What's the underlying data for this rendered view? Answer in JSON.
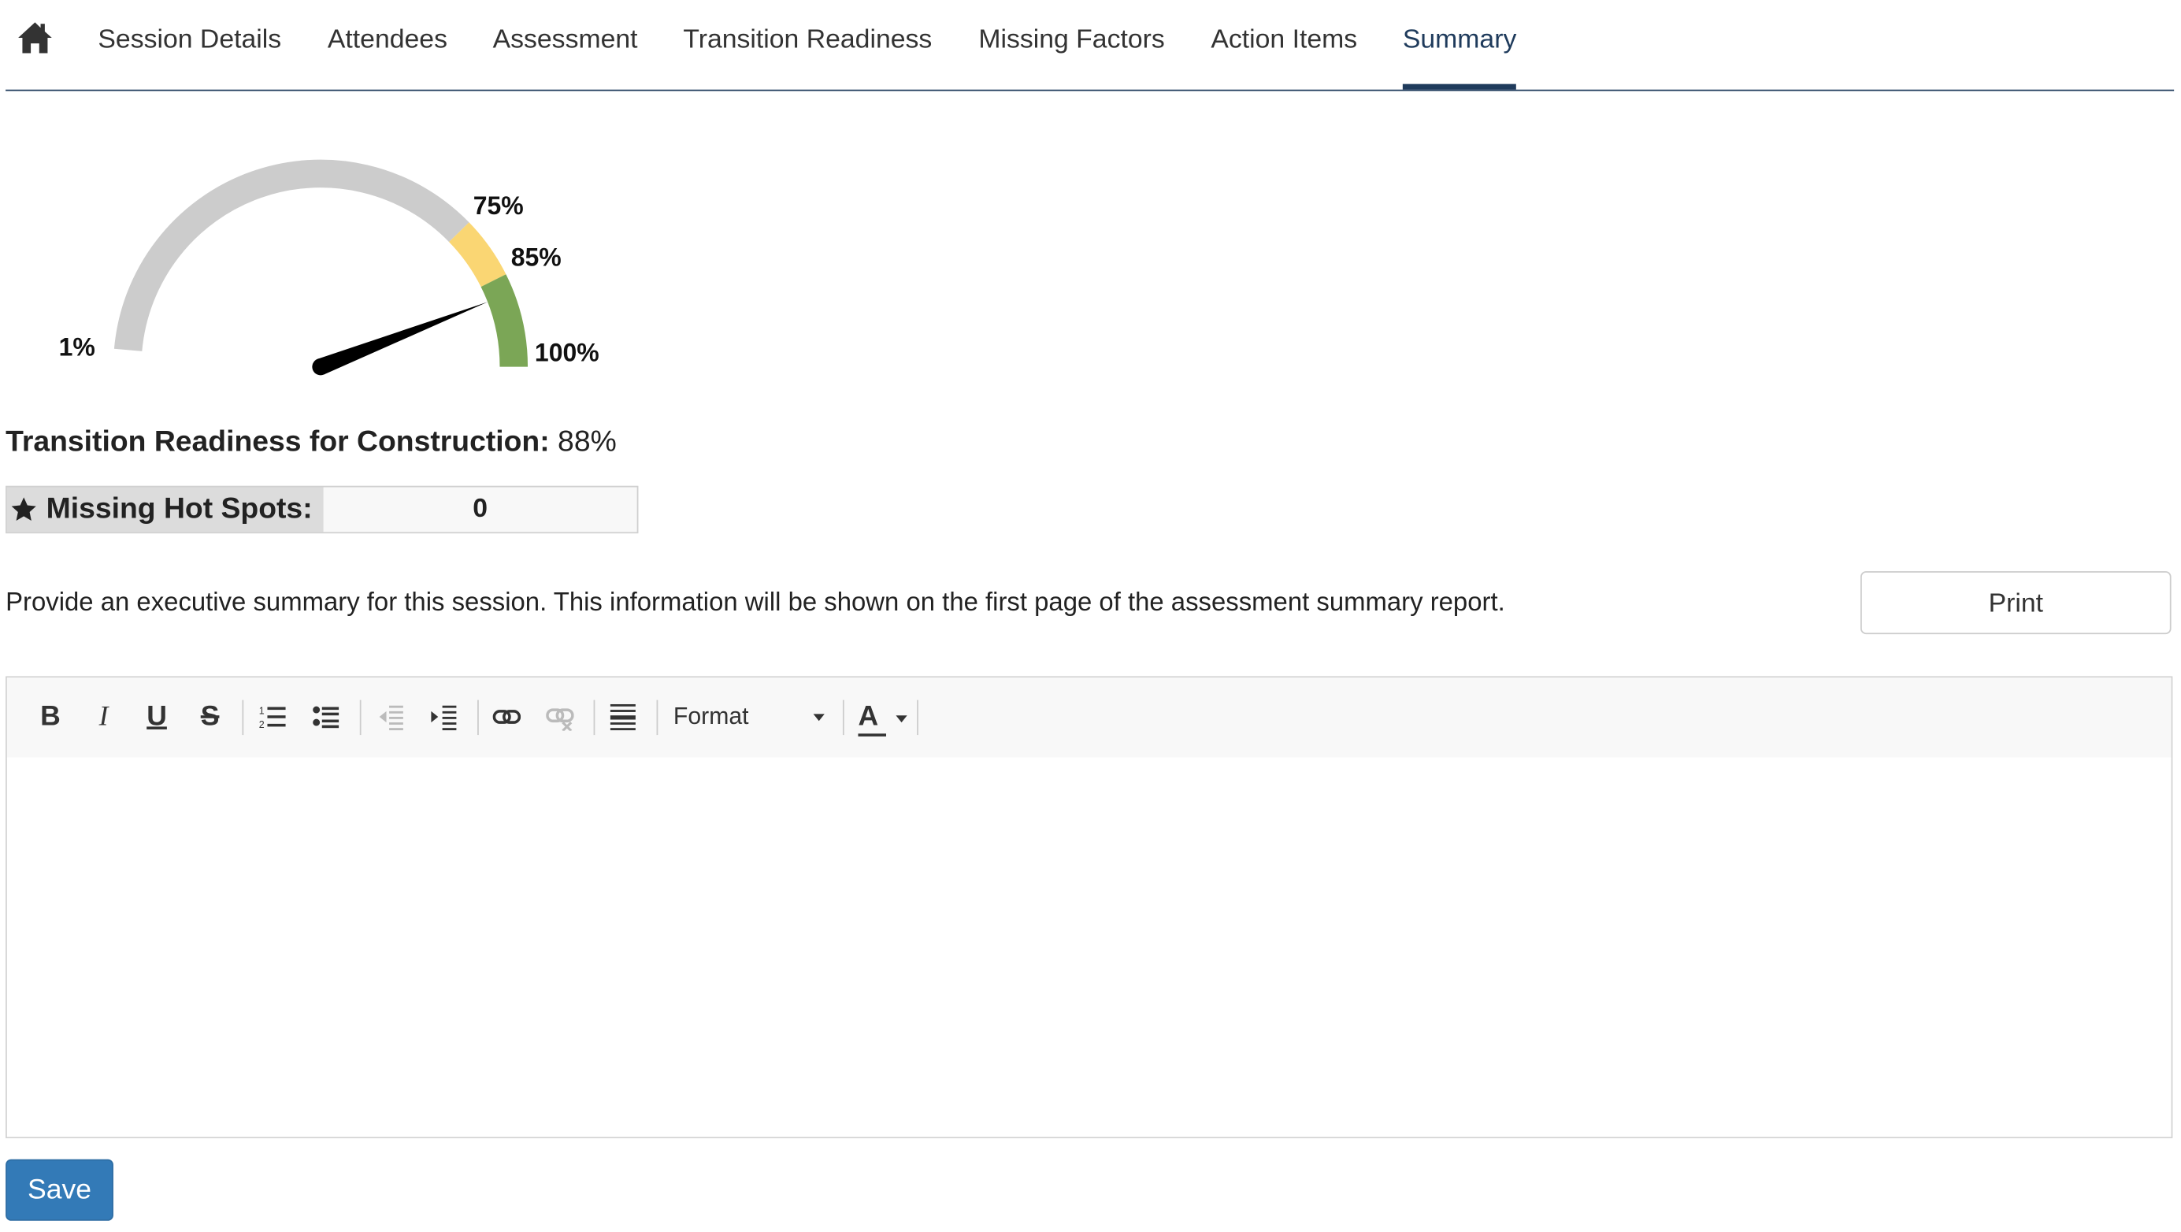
{
  "nav": {
    "home_icon": "home-icon",
    "tabs": [
      {
        "label": "Session Details"
      },
      {
        "label": "Attendees"
      },
      {
        "label": "Assessment"
      },
      {
        "label": "Transition Readiness"
      },
      {
        "label": "Missing Factors"
      },
      {
        "label": "Action Items"
      },
      {
        "label": "Summary"
      }
    ],
    "active_tab": "Summary",
    "accent_color": "#1f3b5c"
  },
  "gauge": {
    "labels": [
      "1%",
      "75%",
      "85%",
      "100%"
    ],
    "value_percent": 88,
    "zones": [
      {
        "from": 1,
        "to": 75,
        "color": "#cccccc"
      },
      {
        "from": 75,
        "to": 85,
        "color": "#fad673"
      },
      {
        "from": 85,
        "to": 100,
        "color": "#7ba656"
      }
    ]
  },
  "readiness": {
    "label": "Transition Readiness for Construction:",
    "value": "88%"
  },
  "hot_spots": {
    "icon": "star-icon",
    "label": "Missing Hot Spots:",
    "value": "0"
  },
  "summary": {
    "instructions": "Provide an executive summary for this session. This information will be shown on the first page of the assessment summary report.",
    "print_label": "Print"
  },
  "editor": {
    "toolbar": {
      "buttons": [
        "bold-icon",
        "italic-icon",
        "underline-icon",
        "strikethrough-icon",
        "numbered-list-icon",
        "bulleted-list-icon",
        "outdent-icon",
        "indent-icon",
        "link-icon",
        "unlink-icon",
        "horizontal-rule-icon"
      ],
      "format_label": "Format",
      "font_color_label": "A"
    },
    "content": ""
  },
  "actions": {
    "save_label": "Save",
    "save_color": "#337ab7"
  }
}
